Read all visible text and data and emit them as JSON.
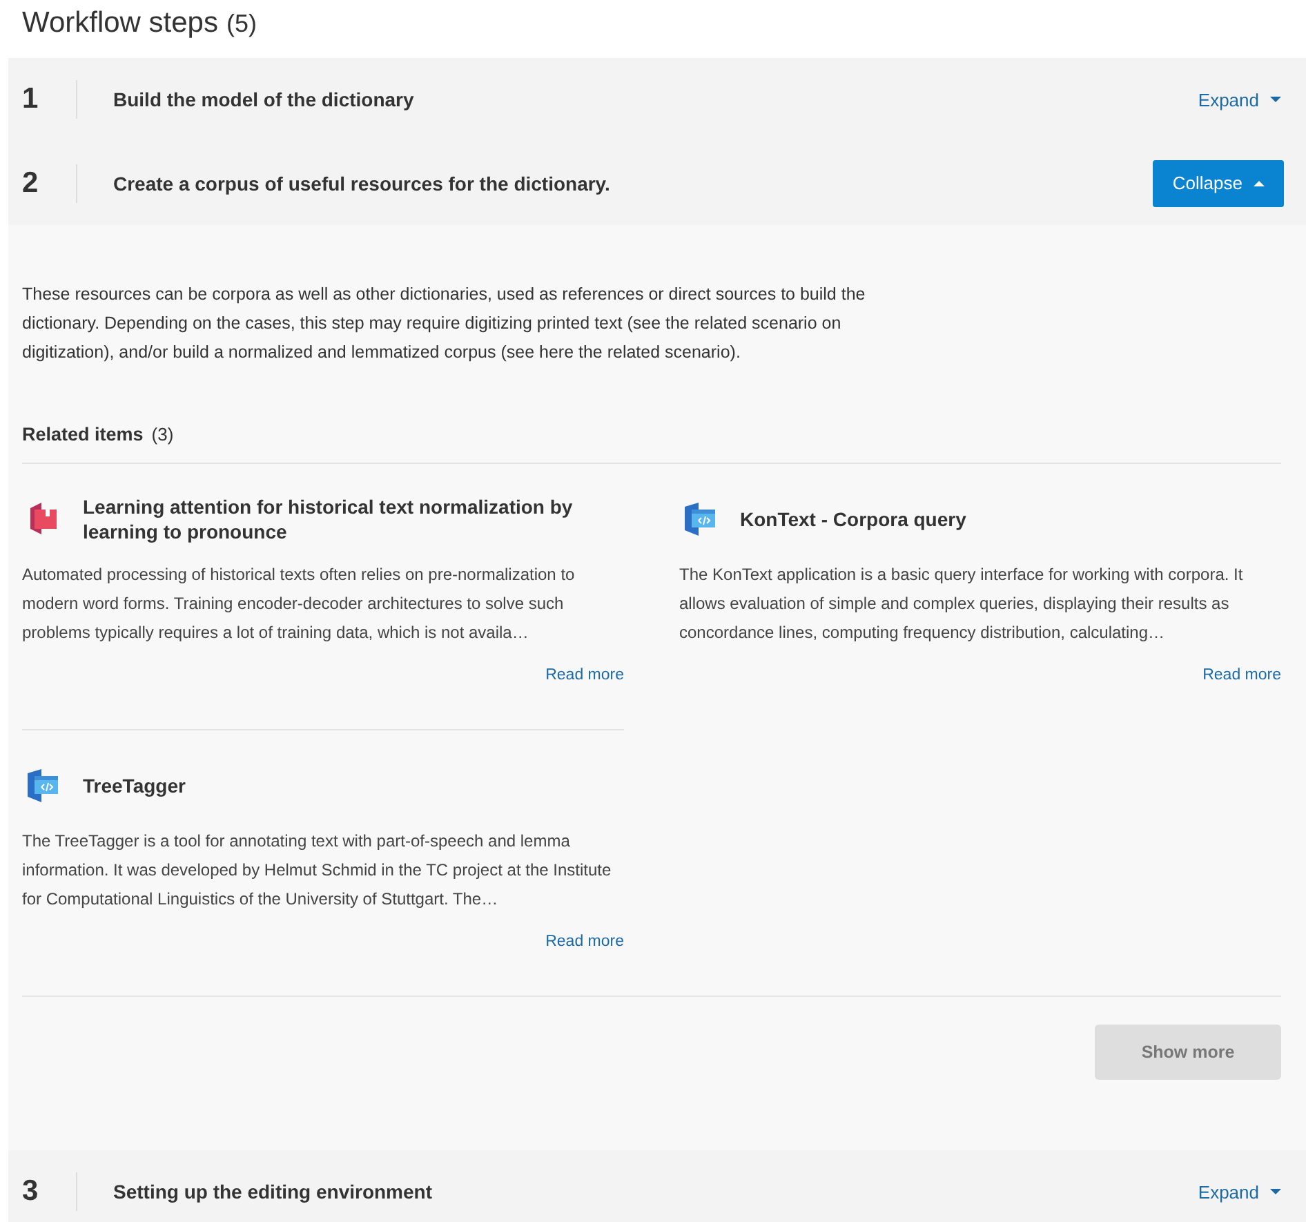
{
  "heading": {
    "title": "Workflow steps",
    "count": "(5)"
  },
  "steps": [
    {
      "number": "1",
      "title": "Build the model of the dictionary",
      "expanded": false,
      "toggle": "Expand"
    },
    {
      "number": "2",
      "title": "Create a corpus of useful resources for the dictionary.",
      "expanded": true,
      "toggle": "Collapse",
      "description": "These resources can be corpora as well as other dictionaries, used as references or direct sources to build the dictionary. Depending on the cases, this step may require digitizing printed text (see the related scenario on digitization), and/or build a normalized and lemmatized corpus (see here the related scenario).",
      "related": {
        "title": "Related items",
        "count": "(3)",
        "items": [
          {
            "kind": "publication",
            "title": "Learning attention for historical text normalization by learning to pronounce",
            "description": "Automated processing of historical texts often relies on pre-normalization to modern word forms. Training encoder-decoder architectures to solve such problems typically requires a lot of training data, which is not availa…",
            "link": "Read more"
          },
          {
            "kind": "tool",
            "title": "KonText - Corpora query",
            "description": "The KonText application is a basic query interface for working with corpora. It allows evaluation of simple and complex queries, displaying their results as concordance lines, computing frequency distribution, calculating…",
            "link": "Read more"
          },
          {
            "kind": "tool",
            "title": "TreeTagger",
            "description": "The TreeTagger is a tool for annotating text with part-of-speech and lemma information. It was developed by Helmut Schmid in the TC project at the Institute for Computational Linguistics of the University of Stuttgart. The…",
            "link": "Read more"
          }
        ],
        "show_more": {
          "label": "Show more",
          "disabled": true
        }
      }
    },
    {
      "number": "3",
      "title": "Setting up the editing environment",
      "expanded": false,
      "toggle": "Expand"
    }
  ]
}
